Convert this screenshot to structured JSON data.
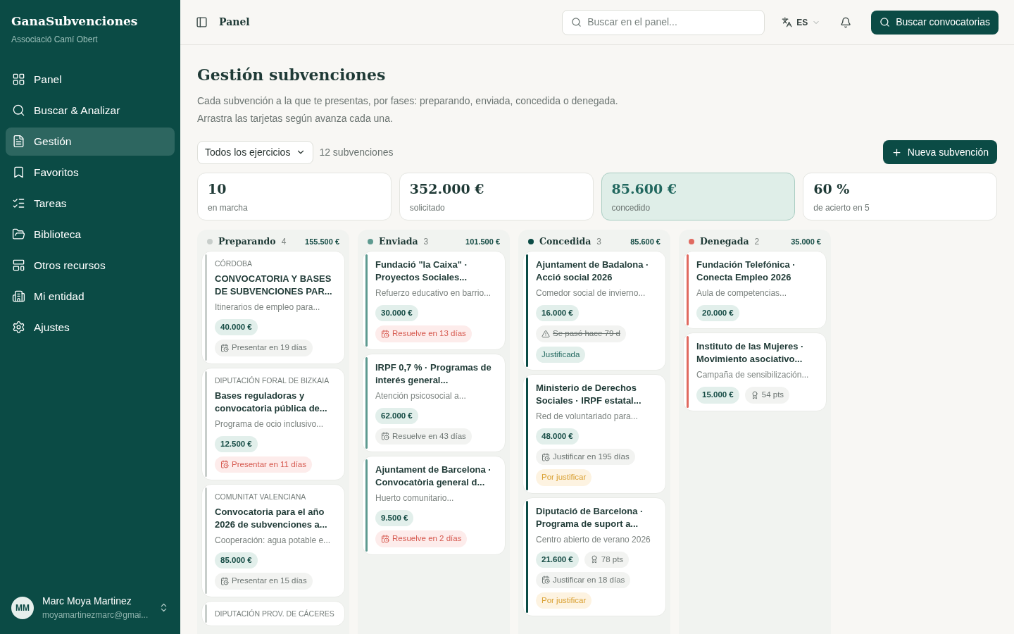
{
  "sidebar": {
    "brand": "GanaSubvenciones",
    "org": "Associació Camí Obert",
    "items": [
      {
        "label": "Panel",
        "selected": false
      },
      {
        "label": "Buscar & Analizar",
        "selected": false
      },
      {
        "label": "Gestión",
        "selected": true
      },
      {
        "label": "Favoritos",
        "selected": false
      },
      {
        "label": "Tareas",
        "selected": false
      },
      {
        "label": "Biblioteca",
        "selected": false
      },
      {
        "label": "Otros recursos",
        "selected": false
      },
      {
        "label": "Mi entidad",
        "selected": false
      },
      {
        "label": "Ajustes",
        "selected": false
      }
    ],
    "user": {
      "initials": "MM",
      "name": "Marc Moya Martinez",
      "email": "moyamartinezmarc@gmai..."
    }
  },
  "header": {
    "breadcrumb": "Panel",
    "search": {
      "placeholder": "Buscar en el panel..."
    },
    "language": "ES",
    "primary_button": "Buscar convocatorias"
  },
  "page": {
    "title": "Gestión subvenciones",
    "description": [
      "Cada subvención a la que te presentas, por fases: preparando, enviada, concedida o denegada.",
      "Arrastra las tarjetas según avanza cada una."
    ],
    "filter": "Todos los ejercicios",
    "count": "12 subvenciones",
    "new_button": "Nueva subvención"
  },
  "stats": [
    {
      "value": "10",
      "label": "en marcha",
      "selected": false
    },
    {
      "value": "352.000 €",
      "label": "solicitado",
      "selected": false
    },
    {
      "value": "85.600 €",
      "label": "concedido",
      "selected": true
    },
    {
      "value": "60 %",
      "label": "de acierto en 5",
      "selected": false
    }
  ],
  "columns": [
    {
      "name": "Preparando",
      "count": "4",
      "total": "155.500 €",
      "color": "#c8cecb",
      "cards": [
        {
          "region": "CÓRDOBA",
          "title": "CONVOCATORIA Y BASES DE SUBVENCIONES PAR...",
          "description": "Itinerarios de empleo para...",
          "amount": "40.000 €",
          "deadline": {
            "text": "Presentar en 19 días",
            "kind": "normal"
          }
        },
        {
          "region": "DIPUTACIÓN FORAL DE BIZKAIA",
          "title": "Bases reguladoras y convocatoria pública de...",
          "description": "Programa de ocio inclusivo...",
          "amount": "12.500 €",
          "deadline": {
            "text": "Presentar en 11 días",
            "kind": "urgent"
          }
        },
        {
          "region": "COMUNITAT VALENCIANA",
          "title": "Convocatoria para el año 2026 de subvenciones a...",
          "description": "Cooperación: agua potable e...",
          "amount": "85.000 €",
          "deadline": {
            "text": "Presentar en 15 días",
            "kind": "normal"
          }
        },
        {
          "region": "DIPUTACIÓN PROV. DE CÁCERES"
        }
      ]
    },
    {
      "name": "Enviada",
      "count": "3",
      "total": "101.500 €",
      "color": "#5e9a90",
      "cards": [
        {
          "title": "Fundació \"la Caixa\" · Proyectos Sociales...",
          "description": "Refuerzo educativo en barrio...",
          "amount": "30.000 €",
          "deadline": {
            "text": "Resuelve en 13 días",
            "kind": "urgent"
          }
        },
        {
          "title": "IRPF 0,7 % · Programas de interés general...",
          "description": "Atención psicosocial a...",
          "amount": "62.000 €",
          "deadline": {
            "text": "Resuelve en 43 días",
            "kind": "normal"
          }
        },
        {
          "title": "Ajuntament de Barcelona · Convocatòria general d...",
          "description": "Huerto comunitario...",
          "amount": "9.500 €",
          "deadline": {
            "text": "Resuelve en 2 días",
            "kind": "urgent"
          }
        }
      ]
    },
    {
      "name": "Concedida",
      "count": "3",
      "total": "85.600 €",
      "color": "#0b4b45",
      "cards": [
        {
          "title": "Ajuntament de Badalona · Acció social 2026",
          "description": "Comedor social de invierno...",
          "amount": "16.000 €",
          "deadline": {
            "text": "Se pasó hace 79 d",
            "kind": "past"
          },
          "status": {
            "text": "Justificada",
            "kind": "done"
          }
        },
        {
          "title": "Ministerio de Derechos Sociales · IRPF estatal...",
          "description": "Red de voluntariado para...",
          "amount": "48.000 €",
          "deadline": {
            "text": "Justificar en 195 días",
            "kind": "normal"
          },
          "status": {
            "text": "Por justificar",
            "kind": "pending"
          }
        },
        {
          "title": "Diputació de Barcelona · Programa de suport a...",
          "description": "Centro abierto de verano 2026",
          "amount": "21.600 €",
          "points": "78 pts",
          "deadline": {
            "text": "Justificar en 18 días",
            "kind": "normal"
          },
          "status": {
            "text": "Por justificar",
            "kind": "pending"
          }
        }
      ]
    },
    {
      "name": "Denegada",
      "count": "2",
      "total": "35.000 €",
      "color": "#e06a60",
      "cards": [
        {
          "title": "Fundación Telefónica · Conecta Empleo 2026",
          "description": "Aula de competencias...",
          "amount": "20.000 €"
        },
        {
          "title": "Instituto de las Mujeres · Movimiento asociativo...",
          "description": "Campaña de sensibilización...",
          "amount": "15.000 €",
          "points": "54 pts"
        }
      ]
    }
  ]
}
